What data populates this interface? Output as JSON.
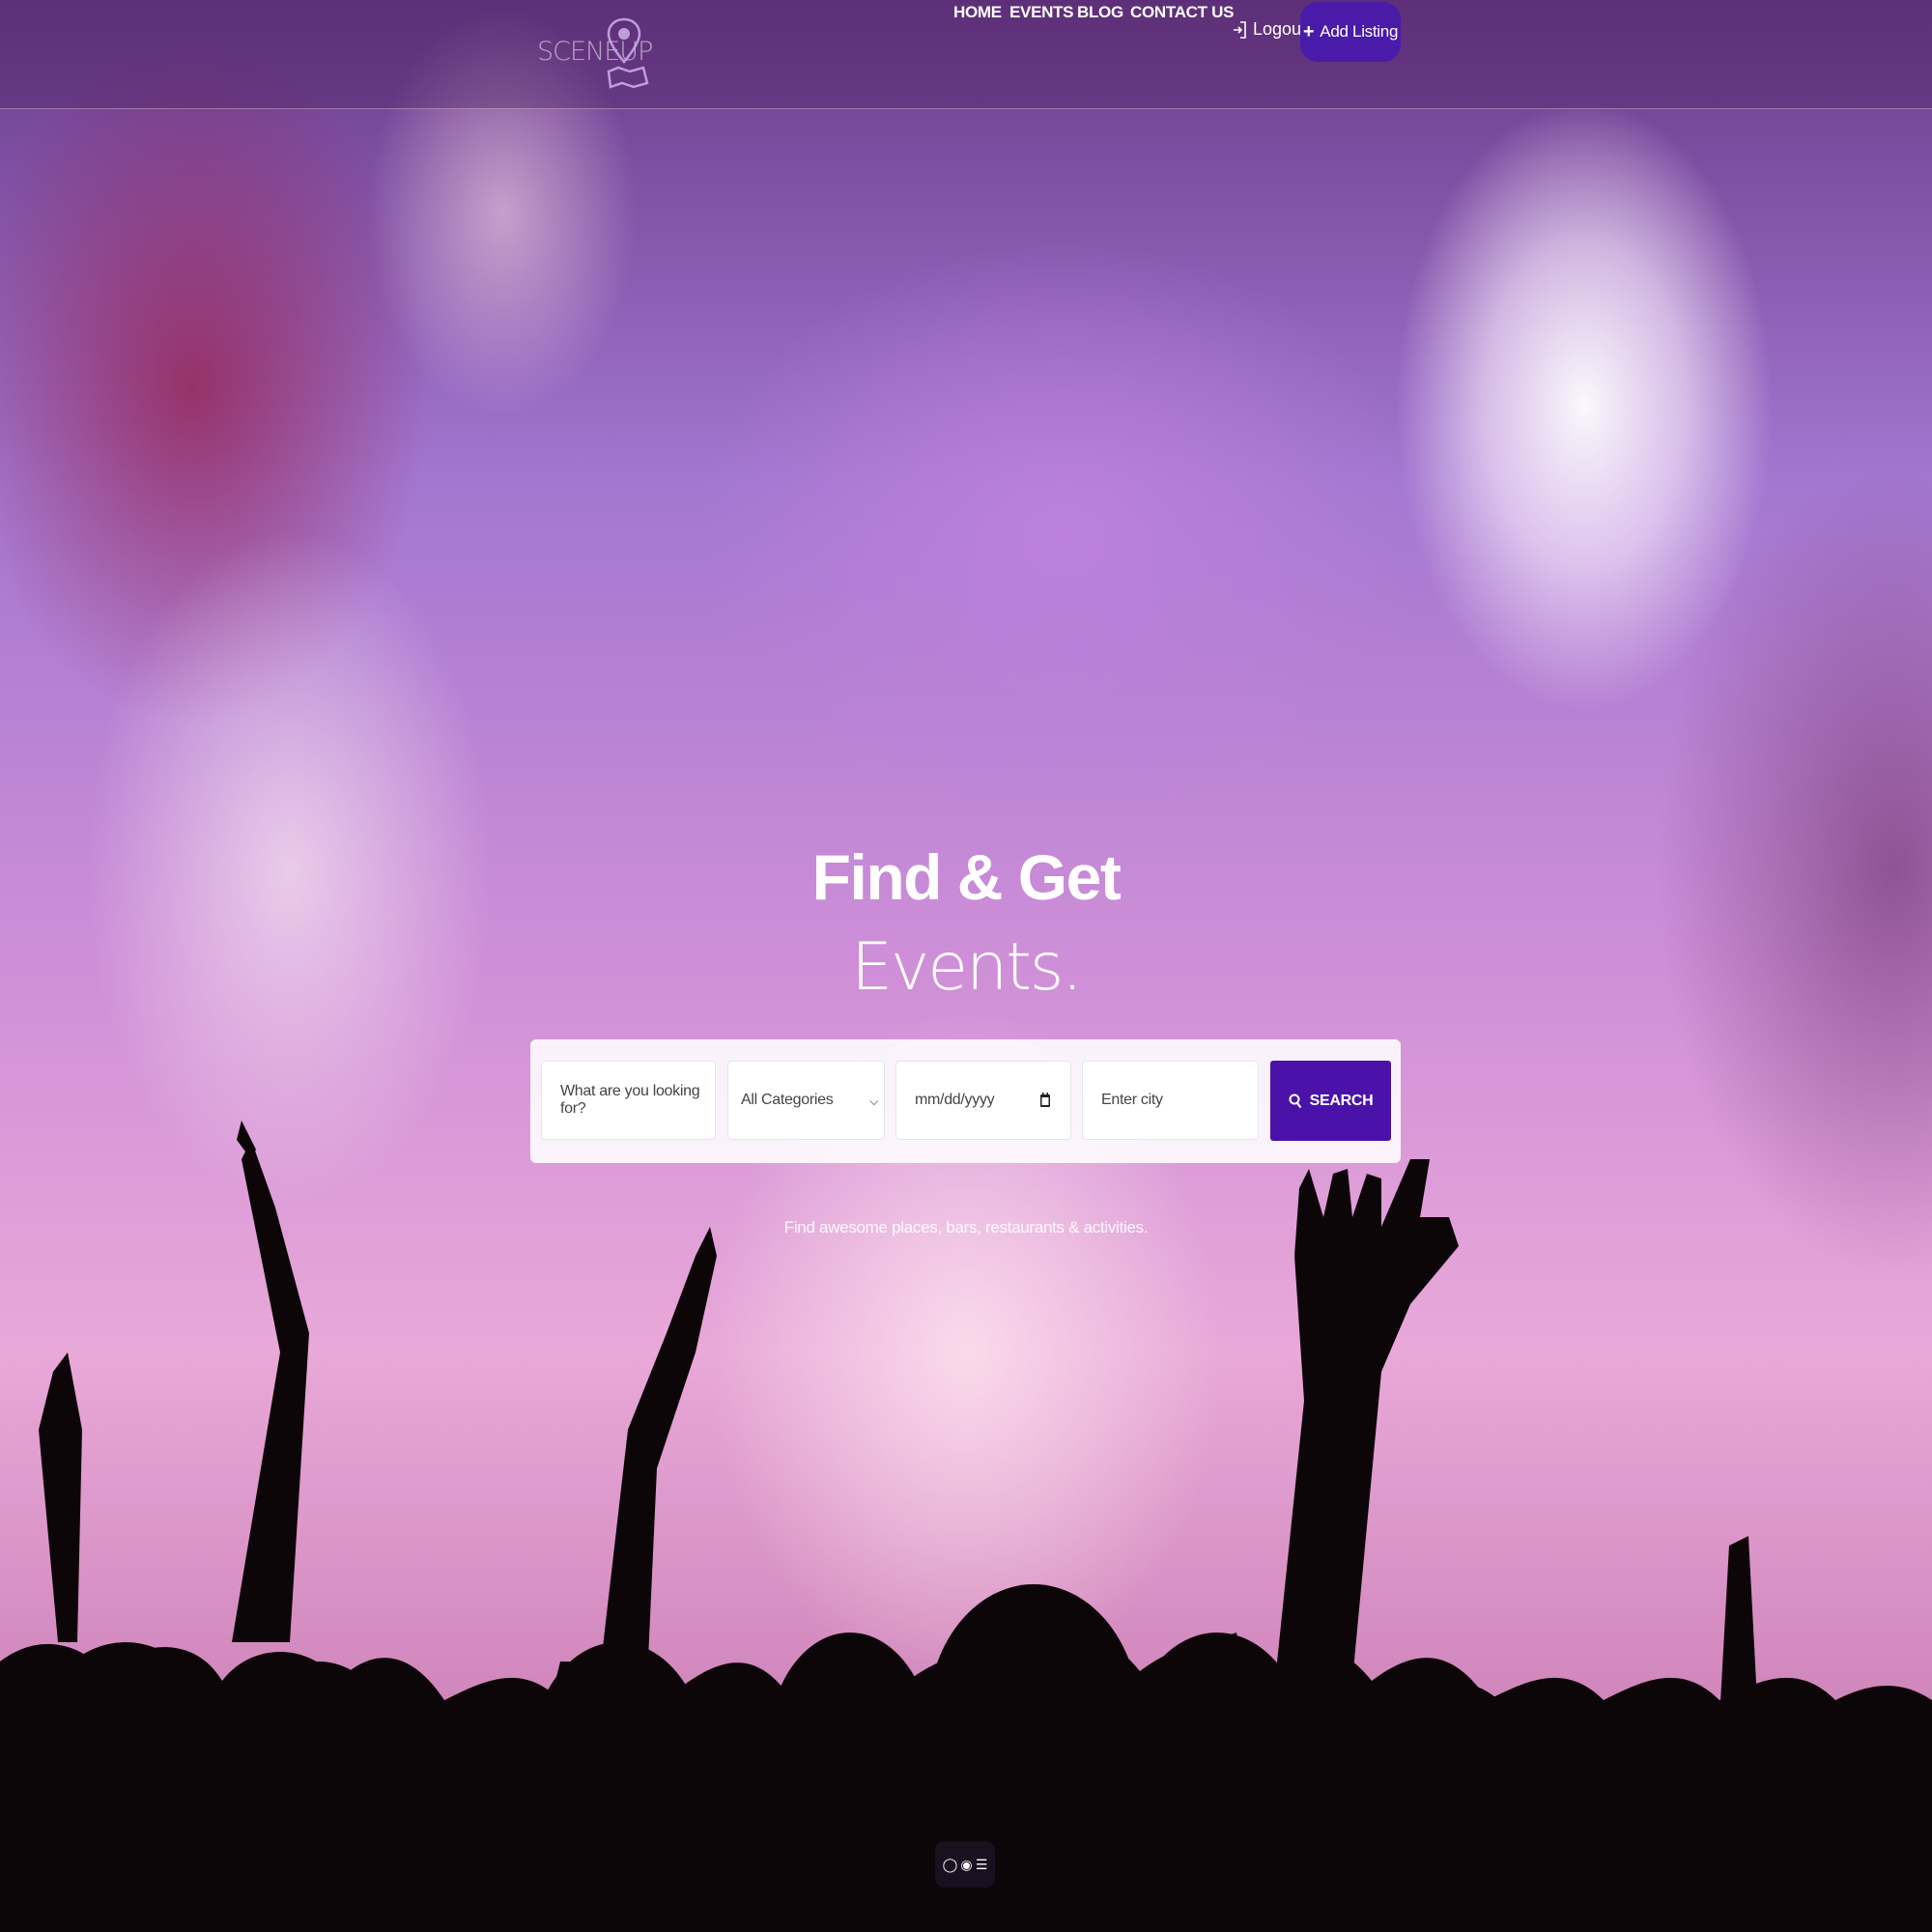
{
  "brand": {
    "logo_text": "SCENEUP"
  },
  "nav": {
    "items": [
      "HOME",
      "EVENTS",
      "BLOG",
      "CONTACT US"
    ],
    "logout_label": "Logout",
    "add_listing_label": "Add Listing"
  },
  "hero": {
    "title": "Find & Get",
    "subtitle": "Events.",
    "tagline": "Find awesome places, bars, restaurants & activities."
  },
  "search": {
    "keyword_placeholder": "What are you looking for?",
    "category_selected": "All Categories",
    "date_placeholder": "mm/dd/yyyy",
    "city_placeholder": "Enter city",
    "button_label": "SEARCH"
  },
  "colors": {
    "accent": "#4a12a8",
    "add_listing_bg": "#4a1aa8"
  },
  "icons": [
    "map-pin-icon",
    "login-icon",
    "plus-icon",
    "calendar-icon",
    "search-icon",
    "chevron-down-icon",
    "chat-icon",
    "settings-icon",
    "list-icon"
  ]
}
